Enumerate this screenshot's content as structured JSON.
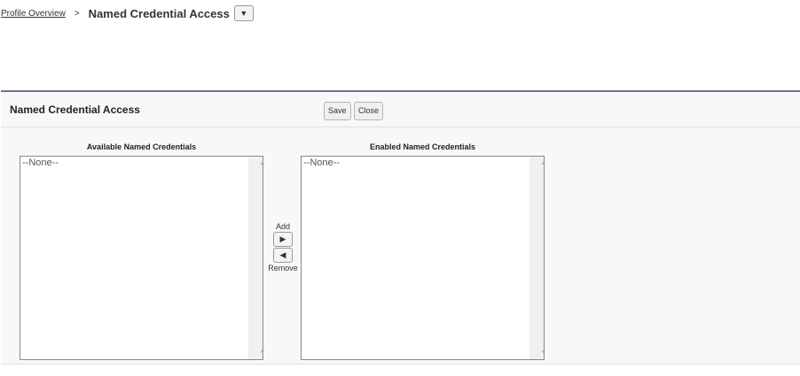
{
  "breadcrumb": {
    "link": "Profile Overview",
    "separator": ">",
    "title": "Named Credential Access"
  },
  "panel": {
    "title": "Named Credential Access",
    "save_label": "Save",
    "close_label": "Close",
    "available": {
      "label": "Available Named Credentials",
      "options": [
        "--None--"
      ]
    },
    "enabled": {
      "label": "Enabled Named Credentials",
      "options": [
        "--None--"
      ]
    },
    "add_label": "Add",
    "remove_label": "Remove"
  }
}
